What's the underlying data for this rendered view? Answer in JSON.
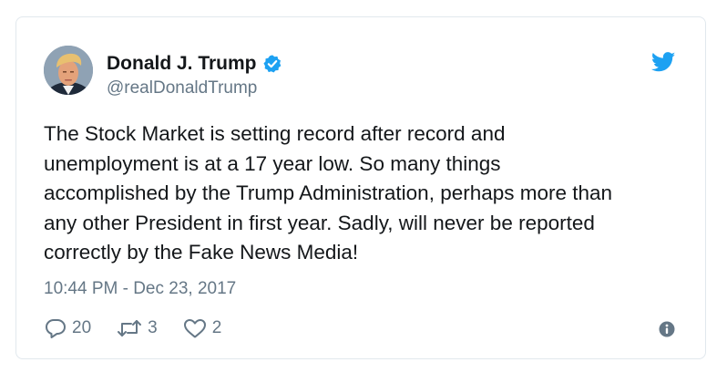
{
  "author": {
    "name": "Donald J. Trump",
    "handle": "@realDonaldTrump",
    "verified": true,
    "avatar_icon": "profile-photo"
  },
  "tweet": {
    "text": "The Stock Market is setting record after record and\nunemployment is at a 17 year low. So many things\naccomplished by the Trump Administration, perhaps more than\nany other President in first year. Sadly, will never be reported\ncorrectly by the Fake News Media!",
    "timestamp": "10:44 PM - Dec 23, 2017"
  },
  "actions": {
    "replies": "20",
    "retweets": "3",
    "likes": "2",
    "reply_icon": "reply-icon",
    "retweet_icon": "retweet-icon",
    "like_icon": "heart-icon",
    "info_icon": "info-icon"
  },
  "colors": {
    "brand": "#1da1f2",
    "text": "#14171a",
    "secondary": "#657786",
    "border": "#e1e8ed"
  }
}
